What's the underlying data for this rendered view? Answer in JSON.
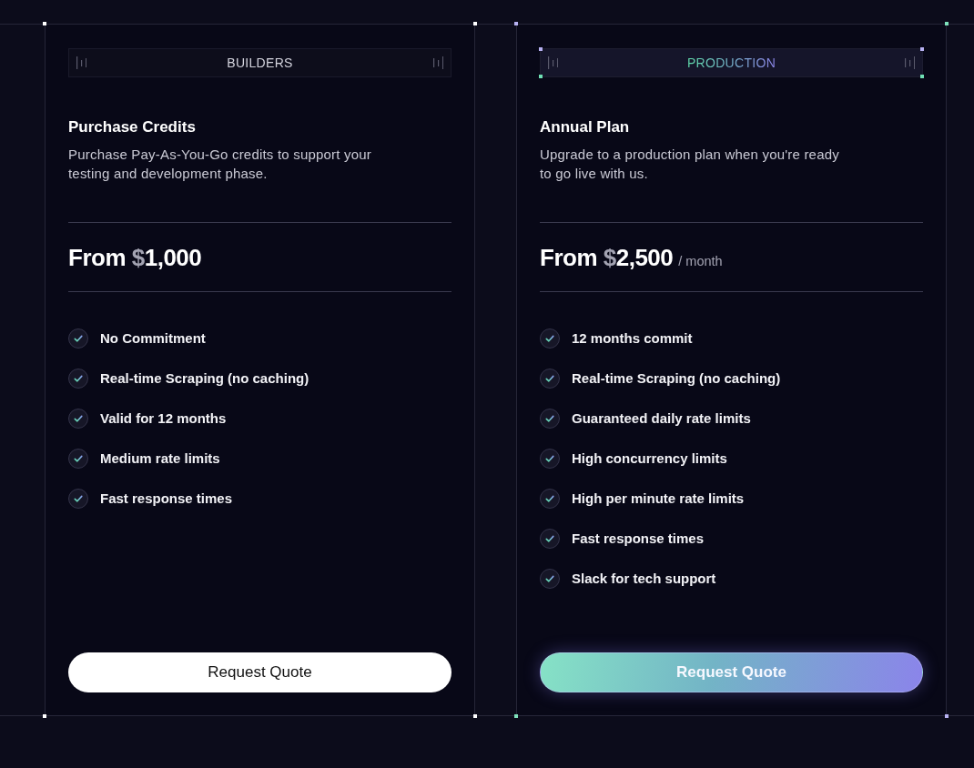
{
  "plans": [
    {
      "badge": "BUILDERS",
      "highlighted": false,
      "title": "Purchase Credits",
      "description": "Purchase Pay-As-You-Go credits to support your testing and development phase.",
      "price": {
        "label": "From",
        "currency": "$",
        "amount": "1,000"
      },
      "features": [
        "No Commitment",
        "Real-time Scraping (no caching)",
        "Valid for 12 months",
        "Medium rate limits",
        "Fast response times"
      ],
      "button": "Request Quote"
    },
    {
      "badge": "PRODUCTION",
      "highlighted": true,
      "title": "Annual Plan",
      "description": "Upgrade to a production plan when you're ready to go live with us.",
      "price": {
        "label": "From",
        "currency": "$",
        "amount": "2,500",
        "period": "/ month"
      },
      "features": [
        "12 months commit",
        "Real-time Scraping (no caching)",
        "Guaranteed daily rate limits",
        "High concurrency limits",
        "High per minute rate limits",
        "Fast response times",
        "Slack for tech support"
      ],
      "button": "Request Quote"
    }
  ]
}
